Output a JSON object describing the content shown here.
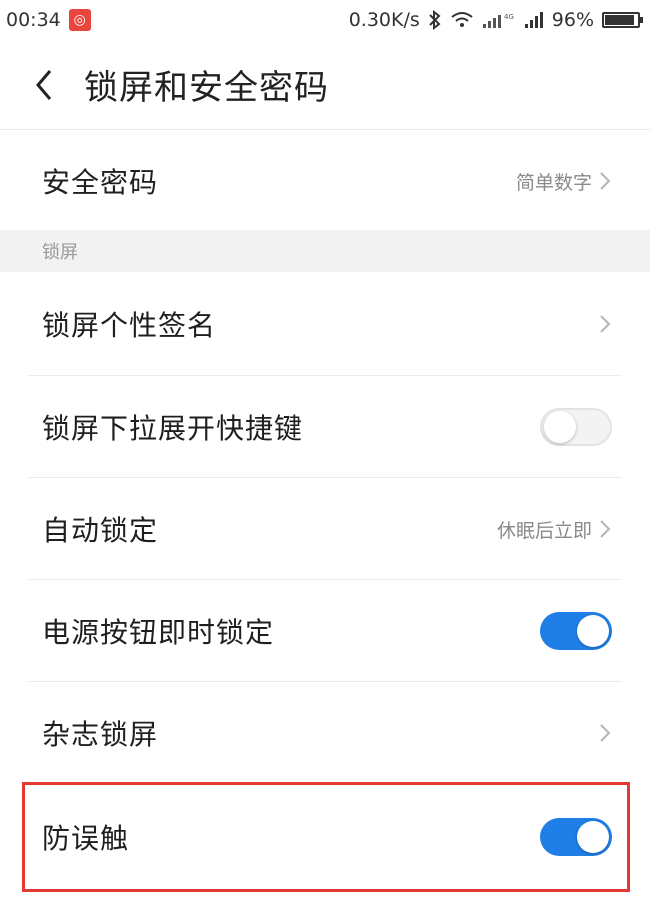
{
  "status_bar": {
    "time": "00:34",
    "net_speed": "0.30K/s",
    "battery_percent": "96%",
    "battery_level": 0.96,
    "icons": [
      "notification-app-icon",
      "bluetooth-icon",
      "wifi-icon",
      "signal-4g-icon",
      "signal-icon",
      "battery-icon"
    ]
  },
  "header": {
    "title": "锁屏和安全密码"
  },
  "rows": {
    "security_password": {
      "label": "安全密码",
      "value": "简单数字"
    },
    "section_lockscreen": {
      "label": "锁屏"
    },
    "signature": {
      "label": "锁屏个性签名"
    },
    "pulldown_shortcut": {
      "label": "锁屏下拉展开快捷键",
      "enabled": false
    },
    "auto_lock": {
      "label": "自动锁定",
      "value": "休眠后立即"
    },
    "power_button_lock": {
      "label": "电源按钮即时锁定",
      "enabled": true
    },
    "magazine_lockscreen": {
      "label": "杂志锁屏"
    },
    "anti_mistouch": {
      "label": "防误触",
      "enabled": true
    }
  },
  "colors": {
    "toggle_on": "#1f7fe6",
    "highlight": "#e53935"
  }
}
